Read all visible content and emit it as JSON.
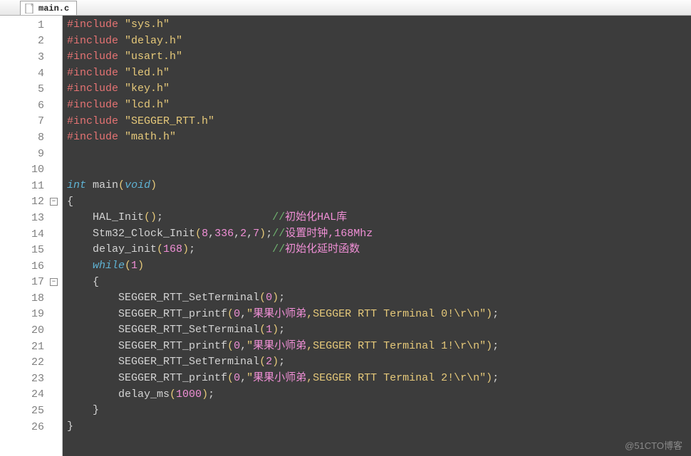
{
  "tab": {
    "filename": "main.c"
  },
  "lines": [
    {
      "n": 1,
      "fold": "",
      "tokens": [
        [
          "preproc",
          "#include"
        ],
        [
          "punct",
          " "
        ],
        [
          "string",
          "\"sys.h\""
        ]
      ]
    },
    {
      "n": 2,
      "fold": "",
      "tokens": [
        [
          "preproc",
          "#include"
        ],
        [
          "punct",
          " "
        ],
        [
          "string",
          "\"delay.h\""
        ]
      ]
    },
    {
      "n": 3,
      "fold": "",
      "tokens": [
        [
          "preproc",
          "#include"
        ],
        [
          "punct",
          " "
        ],
        [
          "string",
          "\"usart.h\""
        ]
      ]
    },
    {
      "n": 4,
      "fold": "",
      "tokens": [
        [
          "preproc",
          "#include"
        ],
        [
          "punct",
          " "
        ],
        [
          "string",
          "\"led.h\""
        ]
      ]
    },
    {
      "n": 5,
      "fold": "",
      "tokens": [
        [
          "preproc",
          "#include"
        ],
        [
          "punct",
          " "
        ],
        [
          "string",
          "\"key.h\""
        ]
      ]
    },
    {
      "n": 6,
      "fold": "",
      "tokens": [
        [
          "preproc",
          "#include"
        ],
        [
          "punct",
          " "
        ],
        [
          "string",
          "\"lcd.h\""
        ]
      ]
    },
    {
      "n": 7,
      "fold": "",
      "tokens": [
        [
          "preproc",
          "#include"
        ],
        [
          "punct",
          " "
        ],
        [
          "string",
          "\"SEGGER_RTT.h\""
        ]
      ]
    },
    {
      "n": 8,
      "fold": "",
      "tokens": [
        [
          "preproc",
          "#include"
        ],
        [
          "punct",
          " "
        ],
        [
          "string",
          "\"math.h\""
        ]
      ]
    },
    {
      "n": 9,
      "fold": "",
      "tokens": []
    },
    {
      "n": 10,
      "fold": "",
      "tokens": []
    },
    {
      "n": 11,
      "fold": "",
      "tokens": [
        [
          "type",
          "int"
        ],
        [
          "punct",
          " "
        ],
        [
          "ident",
          "main"
        ],
        [
          "paren",
          "("
        ],
        [
          "keyword",
          "void"
        ],
        [
          "paren",
          ")"
        ]
      ]
    },
    {
      "n": 12,
      "fold": "-",
      "tokens": [
        [
          "brace",
          "{"
        ]
      ]
    },
    {
      "n": 13,
      "fold": "",
      "tokens": [
        [
          "punct",
          "    "
        ],
        [
          "ident",
          "HAL_Init"
        ],
        [
          "paren",
          "()"
        ],
        [
          "punct",
          ";"
        ],
        [
          "punct",
          "                 "
        ],
        [
          "comment",
          "//"
        ],
        [
          "commentcn",
          "初始化HAL库"
        ]
      ]
    },
    {
      "n": 14,
      "fold": "",
      "tokens": [
        [
          "punct",
          "    "
        ],
        [
          "ident",
          "Stm32_Clock_Init"
        ],
        [
          "paren",
          "("
        ],
        [
          "number",
          "8"
        ],
        [
          "punct",
          ","
        ],
        [
          "number",
          "336"
        ],
        [
          "punct",
          ","
        ],
        [
          "number",
          "2"
        ],
        [
          "punct",
          ","
        ],
        [
          "number",
          "7"
        ],
        [
          "paren",
          ")"
        ],
        [
          "punct",
          ";"
        ],
        [
          "comment",
          "//"
        ],
        [
          "commentcn",
          "设置时钟,168Mhz"
        ]
      ]
    },
    {
      "n": 15,
      "fold": "",
      "tokens": [
        [
          "punct",
          "    "
        ],
        [
          "ident",
          "delay_init"
        ],
        [
          "paren",
          "("
        ],
        [
          "number",
          "168"
        ],
        [
          "paren",
          ")"
        ],
        [
          "punct",
          ";"
        ],
        [
          "punct",
          "            "
        ],
        [
          "comment",
          "//"
        ],
        [
          "commentcn",
          "初始化延时函数"
        ]
      ]
    },
    {
      "n": 16,
      "fold": "",
      "tokens": [
        [
          "punct",
          "    "
        ],
        [
          "keyword",
          "while"
        ],
        [
          "paren",
          "("
        ],
        [
          "number",
          "1"
        ],
        [
          "paren",
          ")"
        ]
      ]
    },
    {
      "n": 17,
      "fold": "-",
      "tokens": [
        [
          "punct",
          "    "
        ],
        [
          "brace",
          "{"
        ]
      ]
    },
    {
      "n": 18,
      "fold": "",
      "tokens": [
        [
          "punct",
          "        "
        ],
        [
          "ident",
          "SEGGER_RTT_SetTerminal"
        ],
        [
          "paren",
          "("
        ],
        [
          "number",
          "0"
        ],
        [
          "paren",
          ")"
        ],
        [
          "punct",
          ";"
        ]
      ]
    },
    {
      "n": 19,
      "fold": "",
      "tokens": [
        [
          "punct",
          "        "
        ],
        [
          "ident",
          "SEGGER_RTT_printf"
        ],
        [
          "paren",
          "("
        ],
        [
          "number",
          "0"
        ],
        [
          "punct",
          ","
        ],
        [
          "string",
          "\""
        ],
        [
          "strcn",
          "果果小师弟"
        ],
        [
          "string",
          ",SEGGER RTT Terminal 0!\\r\\n\""
        ],
        [
          "paren",
          ")"
        ],
        [
          "punct",
          ";"
        ]
      ]
    },
    {
      "n": 20,
      "fold": "",
      "tokens": [
        [
          "punct",
          "        "
        ],
        [
          "ident",
          "SEGGER_RTT_SetTerminal"
        ],
        [
          "paren",
          "("
        ],
        [
          "number",
          "1"
        ],
        [
          "paren",
          ")"
        ],
        [
          "punct",
          ";"
        ]
      ]
    },
    {
      "n": 21,
      "fold": "",
      "tokens": [
        [
          "punct",
          "        "
        ],
        [
          "ident",
          "SEGGER_RTT_printf"
        ],
        [
          "paren",
          "("
        ],
        [
          "number",
          "0"
        ],
        [
          "punct",
          ","
        ],
        [
          "string",
          "\""
        ],
        [
          "strcn",
          "果果小师弟"
        ],
        [
          "string",
          ",SEGGER RTT Terminal 1!\\r\\n\""
        ],
        [
          "paren",
          ")"
        ],
        [
          "punct",
          ";"
        ]
      ]
    },
    {
      "n": 22,
      "fold": "",
      "tokens": [
        [
          "punct",
          "        "
        ],
        [
          "ident",
          "SEGGER_RTT_SetTerminal"
        ],
        [
          "paren",
          "("
        ],
        [
          "number",
          "2"
        ],
        [
          "paren",
          ")"
        ],
        [
          "punct",
          ";"
        ]
      ]
    },
    {
      "n": 23,
      "fold": "",
      "tokens": [
        [
          "punct",
          "        "
        ],
        [
          "ident",
          "SEGGER_RTT_printf"
        ],
        [
          "paren",
          "("
        ],
        [
          "number",
          "0"
        ],
        [
          "punct",
          ","
        ],
        [
          "string",
          "\""
        ],
        [
          "strcn",
          "果果小师弟"
        ],
        [
          "string",
          ",SEGGER RTT Terminal 2!\\r\\n\""
        ],
        [
          "paren",
          ")"
        ],
        [
          "punct",
          ";"
        ]
      ]
    },
    {
      "n": 24,
      "fold": "",
      "tokens": [
        [
          "punct",
          "        "
        ],
        [
          "ident",
          "delay_ms"
        ],
        [
          "paren",
          "("
        ],
        [
          "number",
          "1000"
        ],
        [
          "paren",
          ")"
        ],
        [
          "punct",
          ";"
        ]
      ]
    },
    {
      "n": 25,
      "fold": "",
      "tokens": [
        [
          "punct",
          "    "
        ],
        [
          "brace",
          "}"
        ]
      ]
    },
    {
      "n": 26,
      "fold": "",
      "tokens": [
        [
          "brace",
          "}"
        ]
      ]
    }
  ],
  "watermark": "@51CTO博客"
}
